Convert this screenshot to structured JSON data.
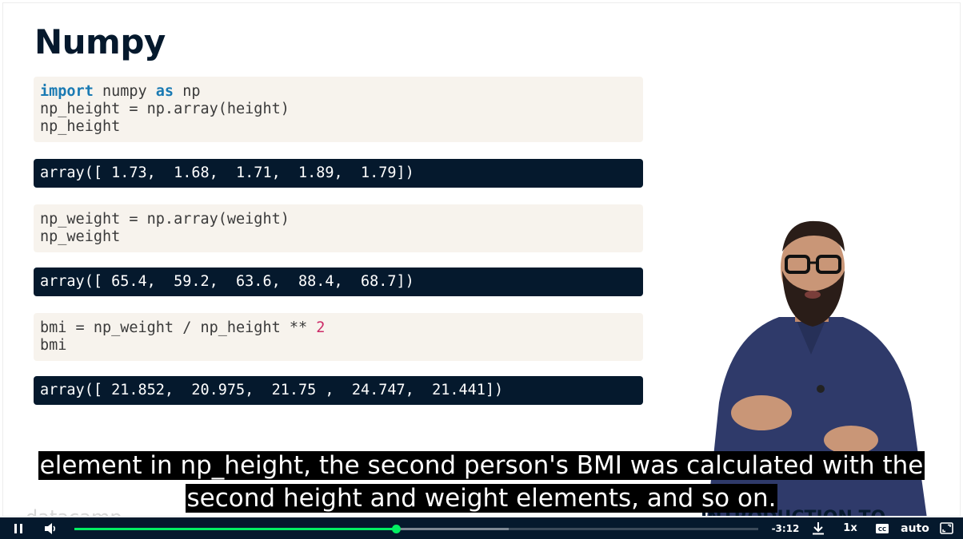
{
  "slide": {
    "title": "Numpy",
    "cells": [
      {
        "type": "in",
        "lines": [
          [
            {
              "t": "import",
              "c": "kw"
            },
            {
              "t": " numpy "
            },
            {
              "t": "as",
              "c": "kw"
            },
            {
              "t": " np"
            }
          ],
          [
            {
              "t": "np_height = np.array(height)"
            }
          ],
          [
            {
              "t": "np_height"
            }
          ]
        ]
      },
      {
        "type": "out",
        "lines": [
          [
            {
              "t": "array([ 1.73,  1.68,  1.71,  1.89,  1.79])"
            }
          ]
        ]
      },
      {
        "type": "in",
        "lines": [
          [
            {
              "t": "np_weight = np.array(weight)"
            }
          ],
          [
            {
              "t": "np_weight"
            }
          ]
        ]
      },
      {
        "type": "out",
        "lines": [
          [
            {
              "t": "array([ 65.4,  59.2,  63.6,  88.4,  68.7])"
            }
          ]
        ]
      },
      {
        "type": "in",
        "lines": [
          [
            {
              "t": "bmi = np_weight / np_height ** "
            },
            {
              "t": "2",
              "c": "num"
            }
          ],
          [
            {
              "t": "bmi"
            }
          ]
        ]
      },
      {
        "type": "out",
        "lines": [
          [
            {
              "t": "array([ 21.852,  20.975,  21.75 ,  24.747,  21.441])"
            }
          ]
        ]
      }
    ],
    "brand": "datacamp",
    "course_title": "INTRODUCTION TO PYTHON"
  },
  "subtitles": {
    "line1": "element in np_height, the second person's BMI was calculated with the",
    "line2": "second height and weight elements, and so on."
  },
  "player": {
    "time_remaining": "-3:12",
    "speed": "1x",
    "quality": "auto",
    "progress": 0.47,
    "buffered": 0.635,
    "icons": {
      "play_pause": "pause-icon",
      "volume": "volume-icon",
      "download": "download-icon",
      "captions": "captions-icon",
      "fullscreen": "fullscreen-icon"
    }
  },
  "colors": {
    "accent": "#03ef62",
    "navy": "#05192d",
    "code_bg": "#f7f3ed"
  }
}
